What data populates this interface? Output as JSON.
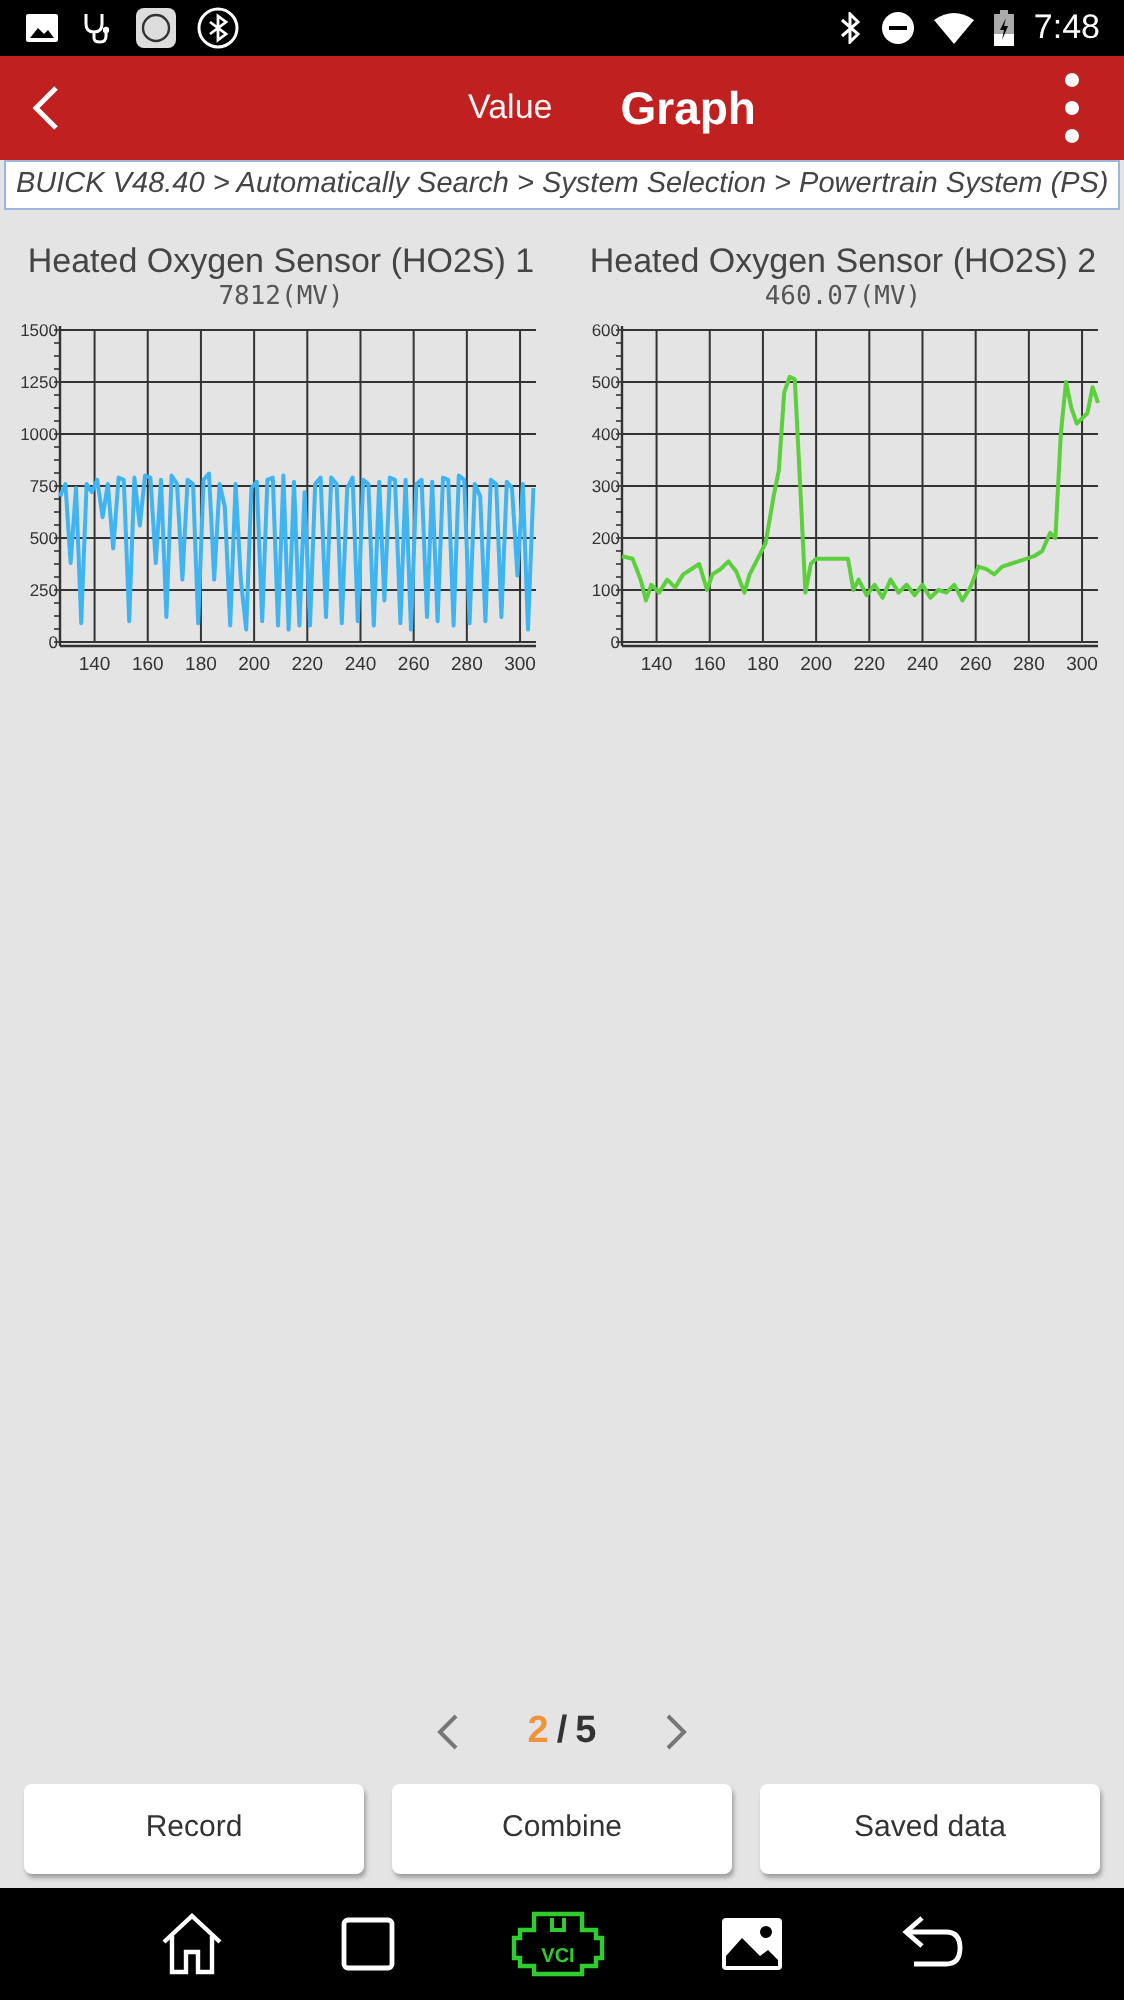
{
  "status_bar": {
    "time": "7:48"
  },
  "header": {
    "tabs": [
      {
        "label": "Value",
        "selected": false
      },
      {
        "label": "Graph",
        "selected": true
      }
    ]
  },
  "breadcrumb": "BUICK V48.40 > Automatically Search > System Selection > Powertrain System (PS)",
  "graphs": [
    {
      "title": "Heated Oxygen Sensor (HO2S) 1",
      "reading": "7812(MV)",
      "chart_data": {
        "type": "line",
        "grid": true,
        "xlim": [
          127,
          306
        ],
        "ylim": [
          0,
          1500
        ],
        "xticks": [
          140,
          160,
          180,
          200,
          220,
          240,
          260,
          280,
          300
        ],
        "yticks": [
          0,
          250,
          500,
          750,
          1000,
          1250,
          1500
        ],
        "x": [
          127,
          129,
          131,
          133,
          135,
          137,
          139,
          141,
          143,
          145,
          147,
          149,
          151,
          153,
          155,
          157,
          159,
          161,
          163,
          165,
          167,
          169,
          171,
          173,
          175,
          177,
          179,
          181,
          183,
          185,
          187,
          189,
          191,
          193,
          195,
          197,
          199,
          201,
          203,
          205,
          207,
          209,
          211,
          213,
          215,
          217,
          219,
          221,
          223,
          225,
          227,
          229,
          231,
          233,
          235,
          237,
          239,
          241,
          243,
          245,
          247,
          249,
          251,
          253,
          255,
          257,
          259,
          261,
          263,
          265,
          267,
          269,
          271,
          273,
          275,
          277,
          279,
          281,
          283,
          285,
          287,
          289,
          291,
          293,
          295,
          297,
          299,
          301,
          303,
          305
        ],
        "series": [
          {
            "color": "#3fb4f0",
            "values": [
              700,
              760,
              380,
              740,
              90,
              760,
              720,
              780,
              600,
              760,
              450,
              790,
              780,
              100,
              790,
              560,
              800,
              790,
              380,
              780,
              120,
              800,
              760,
              300,
              780,
              760,
              90,
              780,
              810,
              300,
              760,
              650,
              80,
              760,
              300,
              60,
              740,
              770,
              100,
              780,
              790,
              80,
              800,
              60,
              770,
              80,
              720,
              80,
              760,
              790,
              120,
              790,
              760,
              90,
              740,
              790,
              100,
              780,
              760,
              80,
              770,
              200,
              790,
              780,
              90,
              780,
              60,
              760,
              780,
              120,
              770,
              100,
              790,
              780,
              80,
              800,
              780,
              90,
              760,
              700,
              100,
              780,
              760,
              120,
              770,
              740,
              320,
              760,
              60,
              740
            ]
          }
        ]
      }
    },
    {
      "title": "Heated Oxygen Sensor (HO2S) 2",
      "reading": "460.07(MV)",
      "chart_data": {
        "type": "line",
        "grid": true,
        "xlim": [
          127,
          306
        ],
        "ylim": [
          0,
          600
        ],
        "xticks": [
          140,
          160,
          180,
          200,
          220,
          240,
          260,
          280,
          300
        ],
        "yticks": [
          0,
          100,
          200,
          300,
          400,
          500,
          600
        ],
        "x": [
          127,
          131,
          134,
          136,
          138,
          141,
          144,
          147,
          150,
          153,
          156,
          159,
          161,
          164,
          167,
          170,
          173,
          175,
          178,
          181,
          184,
          186,
          188,
          190,
          192,
          194,
          196,
          198,
          200,
          204,
          208,
          212,
          214,
          216,
          219,
          222,
          225,
          228,
          231,
          234,
          237,
          240,
          243,
          246,
          249,
          252,
          255,
          258,
          261,
          264,
          267,
          270,
          273,
          276,
          279,
          282,
          285,
          288,
          290,
          292,
          294,
          296,
          298,
          300,
          302,
          304,
          306
        ],
        "series": [
          {
            "color": "#5ccf3c",
            "values": [
              165,
              160,
              120,
              80,
              110,
              95,
              120,
              105,
              130,
              140,
              150,
              100,
              130,
              140,
              155,
              135,
              95,
              130,
              160,
              190,
              280,
              330,
              480,
              510,
              505,
              300,
              95,
              150,
              160,
              160,
              160,
              160,
              100,
              120,
              90,
              110,
              85,
              120,
              95,
              110,
              90,
              110,
              85,
              100,
              95,
              110,
              80,
              105,
              145,
              140,
              130,
              145,
              150,
              155,
              160,
              165,
              175,
              210,
              200,
              400,
              500,
              450,
              420,
              430,
              440,
              490,
              460
            ]
          }
        ]
      }
    }
  ],
  "pager": {
    "current": "2",
    "separator": "/",
    "total": "5"
  },
  "buttons": [
    "Record",
    "Combine",
    "Saved data"
  ],
  "nav_bar": {
    "vci_label": "VCI"
  }
}
